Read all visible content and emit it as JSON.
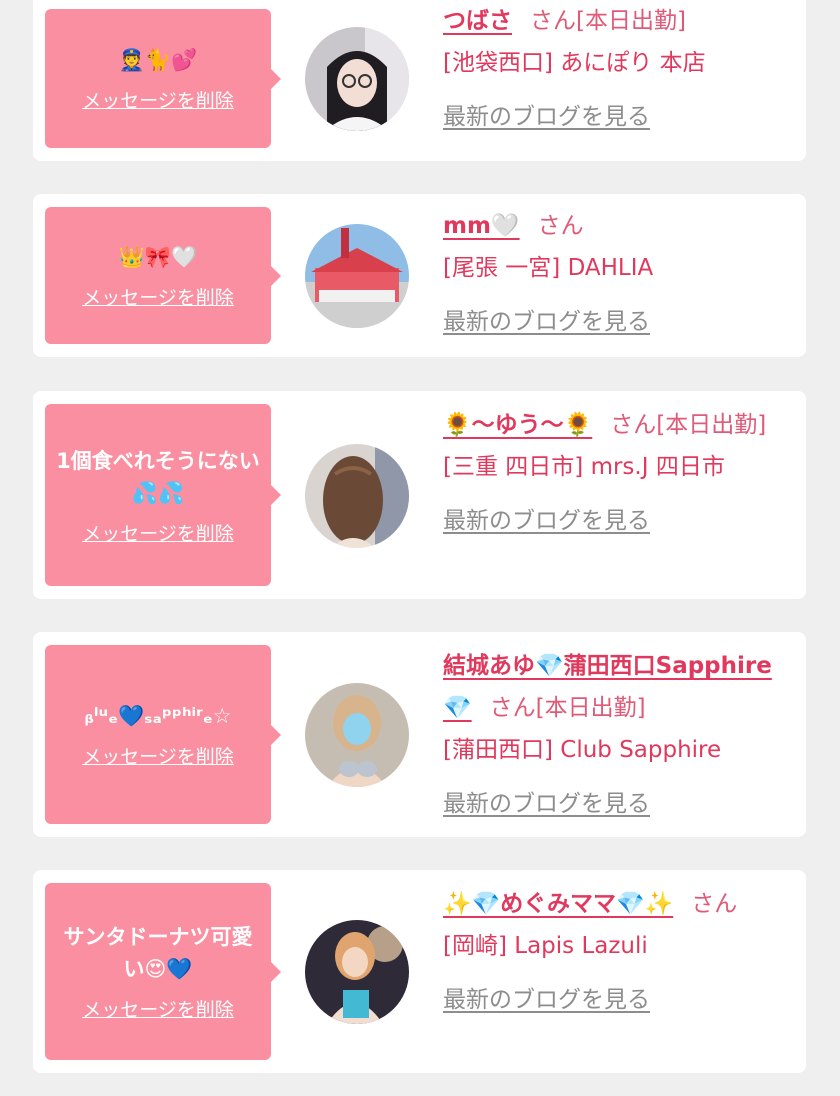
{
  "colors": {
    "accent": "#e0395d",
    "bubble": "#f98fa1",
    "background": "#efefef",
    "link_gray": "#8d8d8d"
  },
  "delete_label": "メッセージを削除",
  "blog_label": "最新のブログを見る",
  "cards": [
    {
      "message": "👮🐈💕",
      "name": "つばさ",
      "suffix": "さん[本日出勤]",
      "shop": "[池袋西口] あにぽり 本店"
    },
    {
      "message": "👑🎀🤍",
      "name": "mm🤍",
      "suffix": "さん",
      "shop": "[尾張 一宮] DAHLIA"
    },
    {
      "message": "1個食べれそうにない💦💦",
      "name": "🌻〜ゆう〜🌻",
      "suffix": "さん[本日出勤]",
      "shop": "[三重 四日市] mrs.J 四日市"
    },
    {
      "message": "ᵦˡᵘₑ💙ₛₐᵖᵖʰⁱʳₑ☆",
      "name": "結城あゆ💎蒲田西口Sapphire💎",
      "suffix": "さん[本日出勤]",
      "shop": "[蒲田西口] Club Sapphire"
    },
    {
      "message": "サンタドーナツ可愛い😍💙",
      "name": "✨💎めぐみママ💎✨",
      "suffix": "さん",
      "shop": "[岡崎] Lapis Lazuli"
    }
  ]
}
